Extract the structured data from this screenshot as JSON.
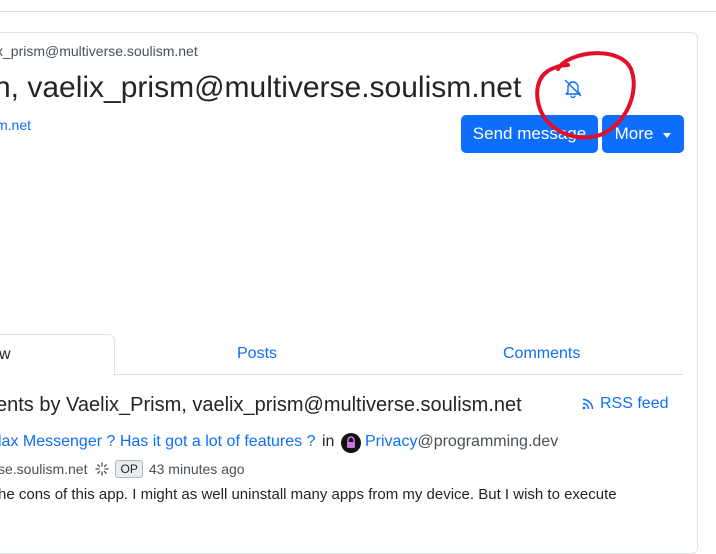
{
  "profile": {
    "handle": "x_prism@multiverse.soulism.net",
    "display_title": "n, vaelix_prism@multiverse.soulism.net",
    "instance_link": "m.net",
    "subscribe_icon": "bell-slash-icon"
  },
  "actions": {
    "send_message": "Send message",
    "more": "More"
  },
  "tabs": [
    {
      "label": "w",
      "active": true
    },
    {
      "label": "Posts",
      "active": false
    },
    {
      "label": "Comments",
      "active": false
    }
  ],
  "section": {
    "title": "ents by Vaelix_Prism, vaelix_prism@multiverse.soulism.net",
    "rss_label": "RSS feed",
    "rss_icon": "rss-icon"
  },
  "post": {
    "title": "lax Messenger ? Has it got a lot of features ?",
    "in_label": "in",
    "community_name": "Privacy",
    "community_domain": "@programming.dev",
    "author_fragment": "se.soulism.net",
    "op_badge": "OP",
    "time": "43 minutes ago",
    "body_snippet": "he cons of this app. I might as well uninstall many apps from my device. But I wish to execute"
  },
  "colors": {
    "primary": "#0d6efd",
    "annotation": "#e0102a"
  }
}
